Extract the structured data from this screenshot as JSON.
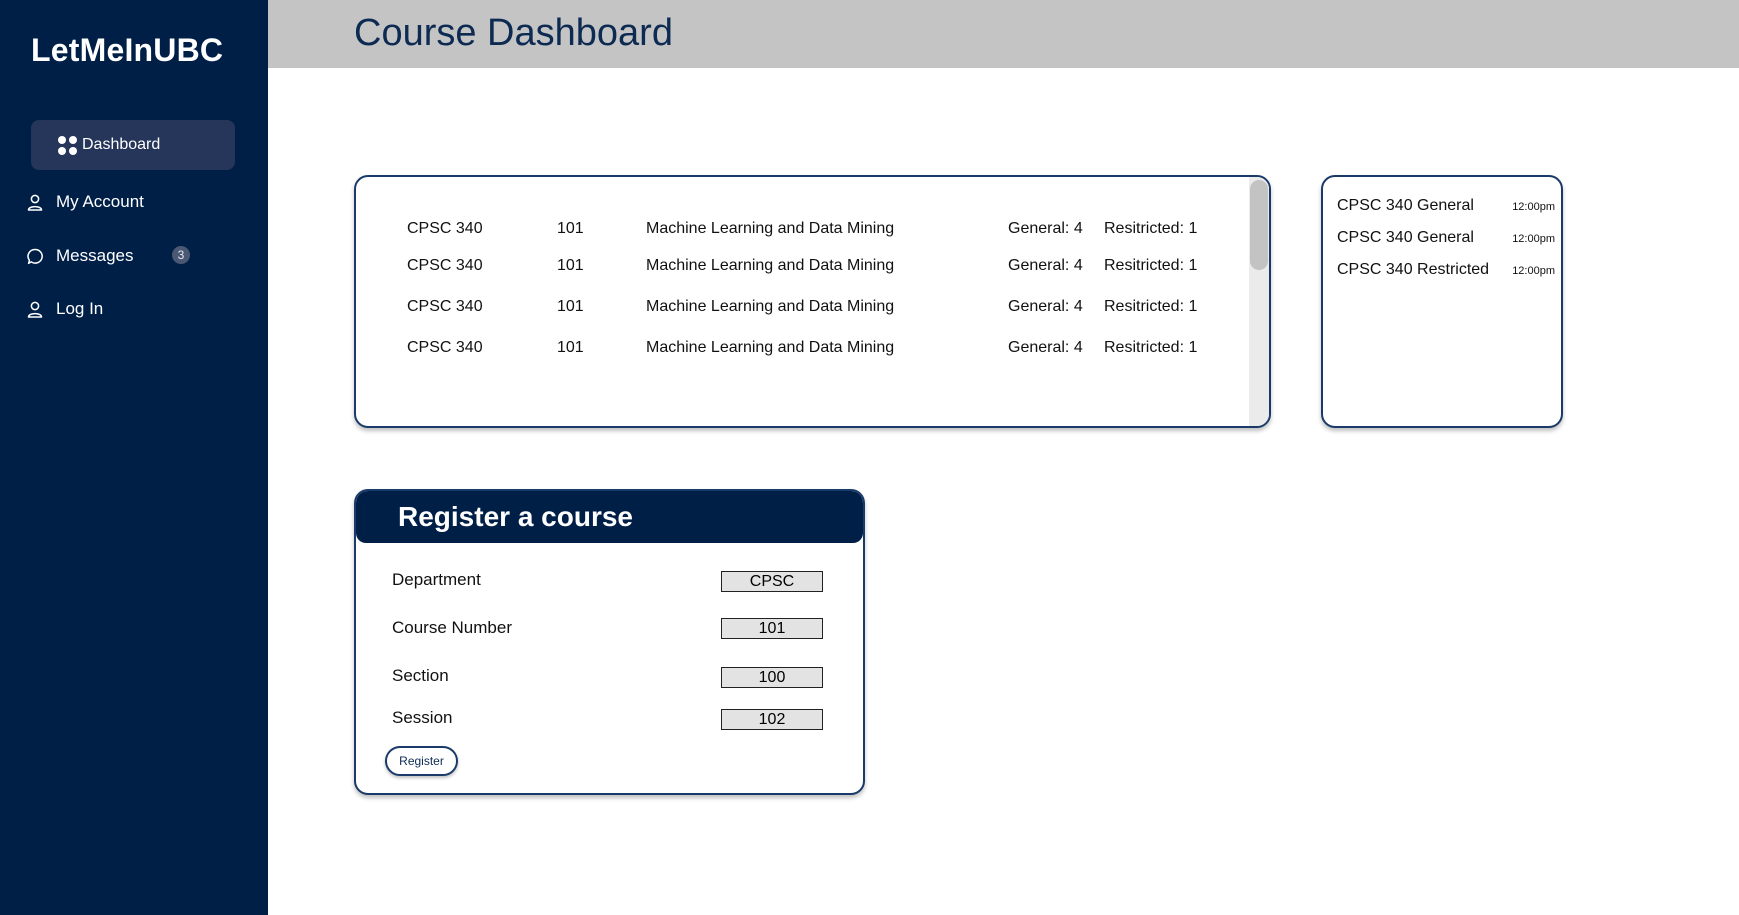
{
  "sidebar": {
    "brand": "LetMeInUBC",
    "items": [
      {
        "label": "Dashboard",
        "icon": "dashboard-dots-icon",
        "active": true
      },
      {
        "label": "My Account",
        "icon": "user-icon"
      },
      {
        "label": "Messages",
        "icon": "chat-bubble-icon",
        "badge": "3"
      },
      {
        "label": "Log In",
        "icon": "user-icon"
      }
    ]
  },
  "header": {
    "title": "Course Dashboard"
  },
  "courses": {
    "rows": [
      {
        "course": "CPSC 340",
        "section": "101",
        "title": "Machine Learning and Data Mining",
        "general": "General: 4",
        "restricted": "Resitricted: 1"
      },
      {
        "course": "CPSC 340",
        "section": "101",
        "title": "Machine Learning and Data Mining",
        "general": "General: 4",
        "restricted": "Resitricted: 1"
      },
      {
        "course": "CPSC 340",
        "section": "101",
        "title": "Machine Learning and Data Mining",
        "general": "General: 4",
        "restricted": "Resitricted: 1"
      },
      {
        "course": "CPSC 340",
        "section": "101",
        "title": "Machine Learning and Data Mining",
        "general": "General: 4",
        "restricted": "Resitricted: 1"
      }
    ]
  },
  "alerts": [
    {
      "label": "CPSC 340 General",
      "time": "12:00pm"
    },
    {
      "label": "CPSC 340 General",
      "time": "12:00pm"
    },
    {
      "label": "CPSC 340 Restricted",
      "time": "12:00pm"
    }
  ],
  "register": {
    "title": "Register a course",
    "fields": [
      {
        "label": "Department",
        "value": "CPSC"
      },
      {
        "label": "Course Number",
        "value": "101"
      },
      {
        "label": "Section",
        "value": "100"
      },
      {
        "label": "Session",
        "value": "102"
      }
    ],
    "button": "Register"
  },
  "colors": {
    "sidebar": "#001f47",
    "nav_active": "#25365a",
    "topbar": "#c4c4c4",
    "title": "#0d2a52",
    "border": "#1a3a6a"
  }
}
